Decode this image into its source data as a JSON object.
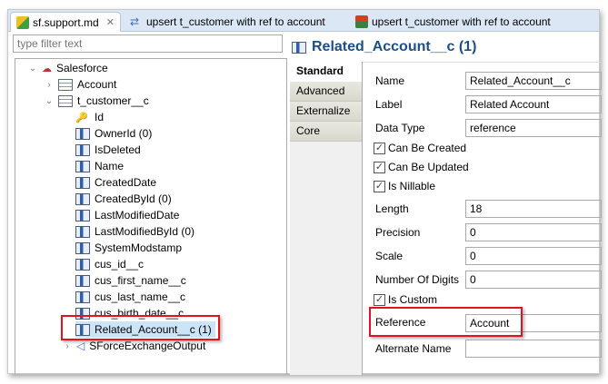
{
  "tabs": [
    {
      "label": "sf.support.md",
      "active": true
    },
    {
      "label": "upsert t_customer with ref to account"
    },
    {
      "label": "upsert t_customer with ref to account"
    }
  ],
  "filter": {
    "placeholder": "type filter text"
  },
  "tree": {
    "root": "Salesforce",
    "account": "Account",
    "customer": "t_customer__c",
    "fields": [
      "Id",
      "OwnerId (0)",
      "IsDeleted",
      "Name",
      "CreatedDate",
      "CreatedById (0)",
      "LastModifiedDate",
      "LastModifiedById (0)",
      "SystemModstamp",
      "cus_id__c",
      "cus_first_name__c",
      "cus_last_name__c",
      "cus_birth_date__c",
      "Related_Account__c (1)"
    ],
    "output": "SForceExchangeOutput",
    "selected": "Related_Account__c (1)"
  },
  "detail": {
    "title": "Related_Account__c (1)",
    "tabs": [
      "Standard",
      "Advanced",
      "Externalize",
      "Core"
    ],
    "name_label": "Name",
    "name": "Related_Account__c",
    "label_label": "Label",
    "label": "Related Account",
    "type_label": "Data Type",
    "type": "reference",
    "can_create": "Can Be Created",
    "can_update": "Can Be Updated",
    "nillable": "Is Nillable",
    "length_label": "Length",
    "length": "18",
    "precision_label": "Precision",
    "precision": "0",
    "scale_label": "Scale",
    "scale": "0",
    "digits_label": "Number Of Digits",
    "digits": "0",
    "custom": "Is Custom",
    "reference_label": "Reference",
    "reference": "Account",
    "alt_label": "Alternate Name",
    "alt": ""
  },
  "colors": {
    "highlight": "#e0141e",
    "title": "#1d4f86"
  }
}
